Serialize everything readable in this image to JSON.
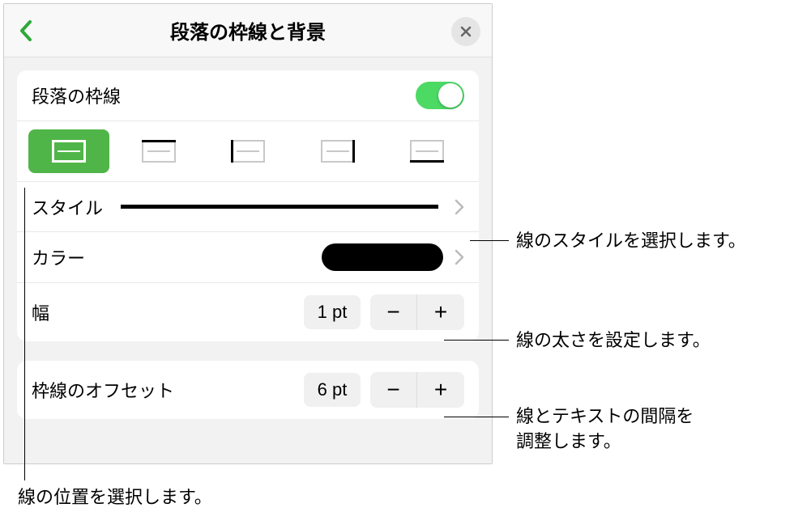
{
  "header": {
    "title": "段落の枠線と背景"
  },
  "toggle_row": {
    "label": "段落の枠線"
  },
  "style_row": {
    "label": "スタイル"
  },
  "color_row": {
    "label": "カラー",
    "color_value": "#000000"
  },
  "width_row": {
    "label": "幅",
    "value": "1 pt"
  },
  "offset_row": {
    "label": "枠線のオフセット",
    "value": "6 pt"
  },
  "callouts": {
    "style": "線のスタイルを選択します。",
    "width": "線の太さを設定します。",
    "offset_line1": "線とテキストの間隔を",
    "offset_line2": "調整します。",
    "position": "線の位置を選択します。"
  },
  "stepper": {
    "minus": "−",
    "plus": "+"
  }
}
